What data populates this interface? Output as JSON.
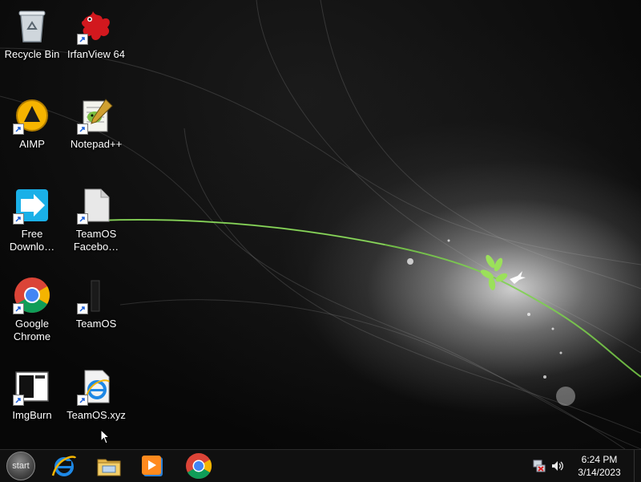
{
  "desktop": {
    "icons": [
      {
        "label": "Recycle Bin",
        "icon": "recycle-bin-icon",
        "shortcut": false
      },
      {
        "label": "IrfanView 64",
        "icon": "irfanview-icon",
        "shortcut": true
      },
      {
        "label": "AIMP",
        "icon": "aimp-icon",
        "shortcut": true
      },
      {
        "label": "Notepad++",
        "icon": "notepad-plus-plus-icon",
        "shortcut": true
      },
      {
        "label": "Free\nDownlo…",
        "icon": "free-download-manager-icon",
        "shortcut": true
      },
      {
        "label": "TeamOS\nFacebo…",
        "icon": "document-icon",
        "shortcut": true
      },
      {
        "label": "Google\nChrome",
        "icon": "chrome-icon",
        "shortcut": true
      },
      {
        "label": "TeamOS",
        "icon": "teamos-icon",
        "shortcut": true
      },
      {
        "label": "ImgBurn",
        "icon": "imgburn-icon",
        "shortcut": true
      },
      {
        "label": "TeamOS.xyz",
        "icon": "internet-explorer-icon",
        "shortcut": true
      }
    ]
  },
  "taskbar": {
    "start_label": "start",
    "pinned": [
      {
        "name": "Internet Explorer",
        "icon": "internet-explorer-icon"
      },
      {
        "name": "File Explorer",
        "icon": "file-explorer-icon"
      },
      {
        "name": "Media Player",
        "icon": "media-player-icon"
      },
      {
        "name": "Google Chrome",
        "icon": "chrome-icon"
      }
    ],
    "tray": {
      "icons": [
        "network-icon",
        "volume-icon"
      ],
      "time": "6:24 PM",
      "date": "3/14/2023"
    }
  },
  "colors": {
    "taskbar": "#101010",
    "accent_green": "#7bd24a",
    "chrome_red": "#db4437",
    "chrome_yellow": "#f4b400",
    "chrome_green": "#0f9d58",
    "chrome_blue": "#4285f4"
  }
}
